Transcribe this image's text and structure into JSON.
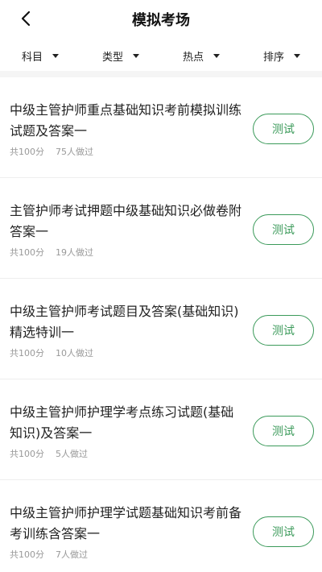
{
  "header": {
    "title": "模拟考场"
  },
  "filters": [
    {
      "label": "科目"
    },
    {
      "label": "类型"
    },
    {
      "label": "热点"
    },
    {
      "label": "排序"
    }
  ],
  "items": [
    {
      "title": "中级主管护师重点基础知识考前模拟训练试题及答案一",
      "score": "共100分",
      "taken": "75人做过",
      "button": "测试"
    },
    {
      "title": "主管护师考试押题中级基础知识必做卷附答案一",
      "score": "共100分",
      "taken": "19人做过",
      "button": "测试"
    },
    {
      "title": "中级主管护师考试题目及答案(基础知识)精选特训一",
      "score": "共100分",
      "taken": "10人做过",
      "button": "测试"
    },
    {
      "title": "中级主管护师护理学考点练习试题(基础知识)及答案一",
      "score": "共100分",
      "taken": "5人做过",
      "button": "测试"
    },
    {
      "title": "中级主管护师护理学试题基础知识考前备考训练含答案一",
      "score": "共100分",
      "taken": "7人做过",
      "button": "测试"
    }
  ],
  "colors": {
    "accent": "#3b9a5a",
    "meta": "#999999",
    "divider": "#f5f5f5"
  },
  "icons": {
    "back": "chevron-left-icon",
    "caret": "caret-down-icon"
  }
}
